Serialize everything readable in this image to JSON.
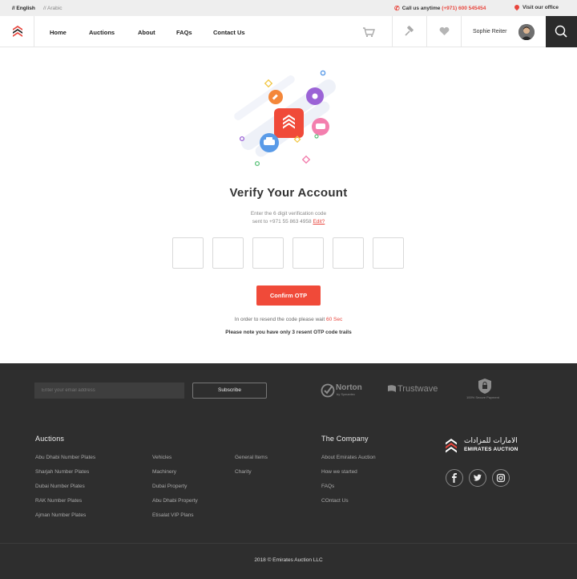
{
  "topbar": {
    "lang_english": "// English",
    "lang_arabic": "// Arabic",
    "phone_label": "Call us anytime",
    "phone_number": "(+971) 600 545454",
    "office_label": "Visit our office"
  },
  "nav": {
    "items": [
      "Home",
      "Auctions",
      "About",
      "FAQs",
      "Contact Us"
    ],
    "user_name": "Sophie Reiter"
  },
  "verify": {
    "title": "Verify Your Account",
    "line1": "Enter the 6 digit verification code",
    "line2_prefix": "sent to +971 55 863 4958",
    "edit_label": "Edit?",
    "confirm_label": "Confirm OTP",
    "resend_text": "In order to resend the code please wait",
    "resend_seconds": "60 Sec",
    "note": "Please note you have only 3 resent OTP code trails"
  },
  "footer": {
    "email_placeholder": "Enter your email address",
    "subscribe_label": "Subscribe",
    "trust": {
      "norton": "Norton",
      "norton_sub": "by Symantec",
      "trustwave": "Trustwave",
      "secure": "100% Secure Payment"
    },
    "auctions_heading": "Auctions",
    "auctions_col1": [
      "Abu Dhabi Number Plates",
      "Sharjah Number Plates",
      "Dubai Number Plates",
      "RAK Number Plates",
      "Ajman Number Plates"
    ],
    "auctions_col2": [
      "Vehicles",
      "Machinery",
      "Dubai Property",
      "Abu Dhabi Property",
      "Etisalat VIP Plans"
    ],
    "auctions_col3": [
      "General Items",
      "Charity"
    ],
    "company_heading": "The Company",
    "company_links": [
      "About Emirates Auction",
      "How we started",
      "FAQs",
      "COntact Us"
    ],
    "brand_arabic": "الامارات للمزادات",
    "brand_english": "EMIRATES AUCTION",
    "copyright": "2018 © Emirates Auction LLC"
  },
  "colors": {
    "accent": "#f04a39",
    "footer_bg": "#2e2e2e",
    "topbar_bg": "#eeeeee"
  }
}
